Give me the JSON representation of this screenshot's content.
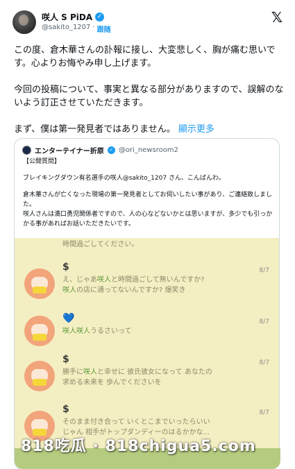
{
  "header": {
    "display_name": "咲人 S PiDA",
    "verified_mark": "✓",
    "handle": "@sakito_1207",
    "separator": "·",
    "follow_label": "跟随",
    "x_logo": "𝕏"
  },
  "post": {
    "paragraphs": [
      "この度、倉木華さんの訃報に接し、大変悲しく、胸が痛む思いです。心よりお悔やみ申し上げます。",
      "今回の投稿について、事実と異なる部分がありますので、誤解のないよう訂正させていただきます。"
    ],
    "last_text": "まず、僕は第一発見者ではありません。",
    "show_more": "顯示更多"
  },
  "quote": {
    "name": "エンターテイナー折原",
    "badge": "✓",
    "handle": "@ori_newsroom2",
    "lines": [
      "【公開質問】",
      "ブレイキングダウン有名選手の咲人@sakito_1207 さん、こんばんわ。",
      "倉木華さんが亡くなった現場の第一発見者としてお伺いしたい事があり、ご連絡致しました。",
      "咲人さんは満口勇児関係者ですので、人の心などないかとは思いますが、多少でも引っかかる事があればお話いただきたいです。"
    ],
    "chat": {
      "top_line": "時間過ごしてください。",
      "messages": [
        {
          "sender": "$",
          "line1_a": "え、じゃあ",
          "line1_hl": "咲人",
          "line1_b": "と時間過ごして無いんですか?",
          "line2_hl": "咲人",
          "line2_b": "の店に通ってないんですか? 爆笑き",
          "time": "8/7"
        },
        {
          "sender": "💙",
          "line1_hl": "咲人咲人",
          "line1_b": "うるさいって",
          "time": "8/7"
        },
        {
          "sender": "$",
          "line1_a": "勝手に",
          "line1_hl": "咲人",
          "line1_b": "と幸せに 彼氏彼女になって あなたの",
          "line2_b": "求める未来を 歩んでくださいを",
          "time": "8/7"
        },
        {
          "sender": "$",
          "line1_b": "そのまま付き合って いくとこまでいったらいい",
          "line2_b": "じゃん 相手がトップダンディーのはるかかな...",
          "time": "8/7"
        }
      ]
    }
  },
  "watermark": "818吃瓜 · 818chigua5.com"
}
